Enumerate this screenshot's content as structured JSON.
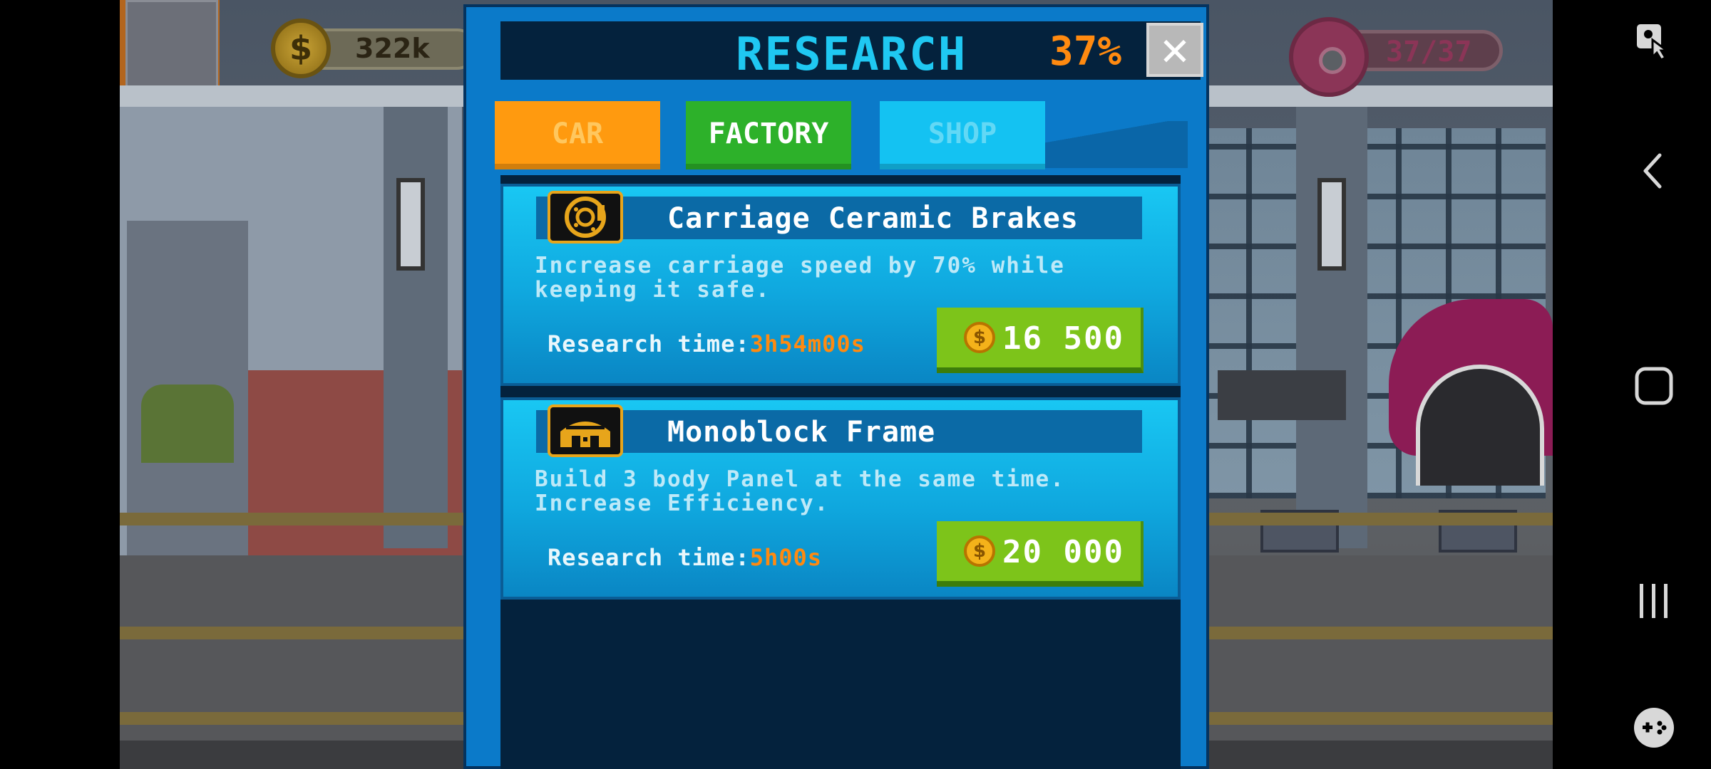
{
  "hud": {
    "coins": "322k",
    "coin_icon": "dollar-coin-icon",
    "coin_symbol": "$",
    "donuts": "37/37",
    "donut_icon": "donut-icon"
  },
  "research_panel": {
    "title": "RESEARCH",
    "progress_percent": "37%",
    "close_symbol": "✕",
    "tabs": [
      {
        "label": "CAR",
        "state": "inactive",
        "color": "#ff9a0f"
      },
      {
        "label": "FACTORY",
        "state": "selected",
        "color": "#2db12a"
      },
      {
        "label": "SHOP",
        "state": "inactive",
        "color": "#14c2f2"
      }
    ],
    "items": [
      {
        "icon": "brake-disc-icon",
        "title": "Carriage Ceramic Brakes",
        "description": "Increase carriage speed by 70% while keeping it safe.",
        "time_label": "Research time:",
        "time_value": "3h54m00s",
        "price": "16 500",
        "coin_symbol": "$"
      },
      {
        "icon": "monoblock-frame-icon",
        "title": "Monoblock Frame",
        "description": "Build 3 body Panel at the same time. Increase Efficiency.",
        "time_label": "Research time:",
        "time_value": "5h00s",
        "price": "20 000",
        "coin_symbol": "$"
      }
    ]
  },
  "system_nav": {
    "icons": [
      "screenshot-touch-icon",
      "back-icon",
      "home-icon",
      "recents-icon",
      "game-tools-icon"
    ]
  },
  "colors": {
    "panel_blue": "#0b7ac9",
    "header_dark": "#04223d",
    "title_cyan": "#1fc8f2",
    "accent_orange": "#ff8a10",
    "buy_green": "#7dc41a"
  }
}
